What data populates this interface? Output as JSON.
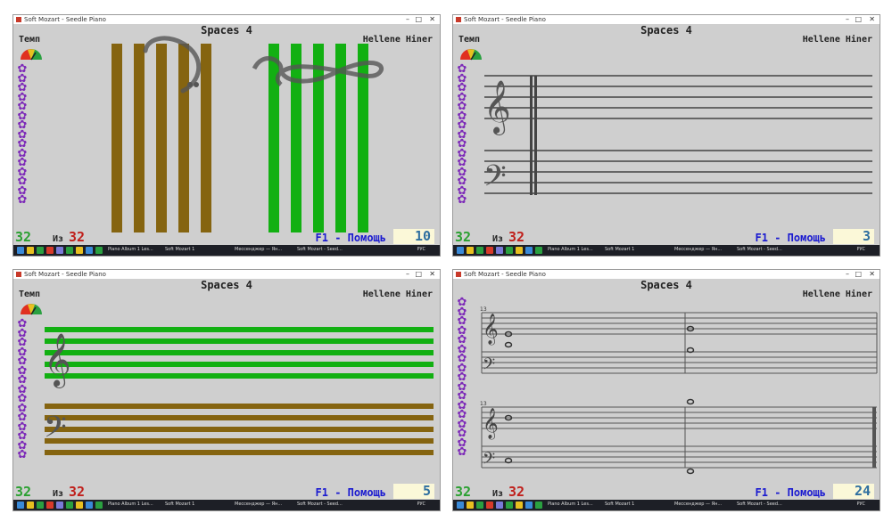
{
  "app": {
    "window_title": "Soft Mozart - Seedle Piano",
    "song_title": "Spaces 4",
    "author": "Hellene Hiner",
    "tempo_label": "Темп",
    "of_label": "Из",
    "help_label": "F1 - Помощь"
  },
  "taskbar": {
    "items": [
      "Piano Album 1 Les...",
      "Soft Mozart 1",
      "Мессенджер — Ян...",
      "Soft Mozart - Seed..."
    ],
    "tray_lang": "РУС"
  },
  "colors": {
    "green_bar": "#12b012",
    "brown_bar": "#856410",
    "staff_line": "#444444",
    "count_green": "#2aa030",
    "total_red": "#c0201c",
    "help_blue": "#1a1ad0",
    "star_purple": "#7d2ab8"
  },
  "panels": [
    {
      "id": "p1",
      "exercise": "32",
      "total": "32",
      "score": "10",
      "view": "vertical-bars",
      "show_tempo": true
    },
    {
      "id": "p2",
      "exercise": "32",
      "total": "32",
      "score": "3",
      "view": "grand-staff-empty",
      "show_tempo": true
    },
    {
      "id": "p3",
      "exercise": "32",
      "total": "32",
      "score": "5",
      "view": "colored-staff",
      "show_tempo": true
    },
    {
      "id": "p4",
      "exercise": "32",
      "total": "32",
      "score": "24",
      "view": "notation-with-notes",
      "show_tempo": false,
      "measure_numbers": [
        "13",
        "13"
      ]
    }
  ]
}
